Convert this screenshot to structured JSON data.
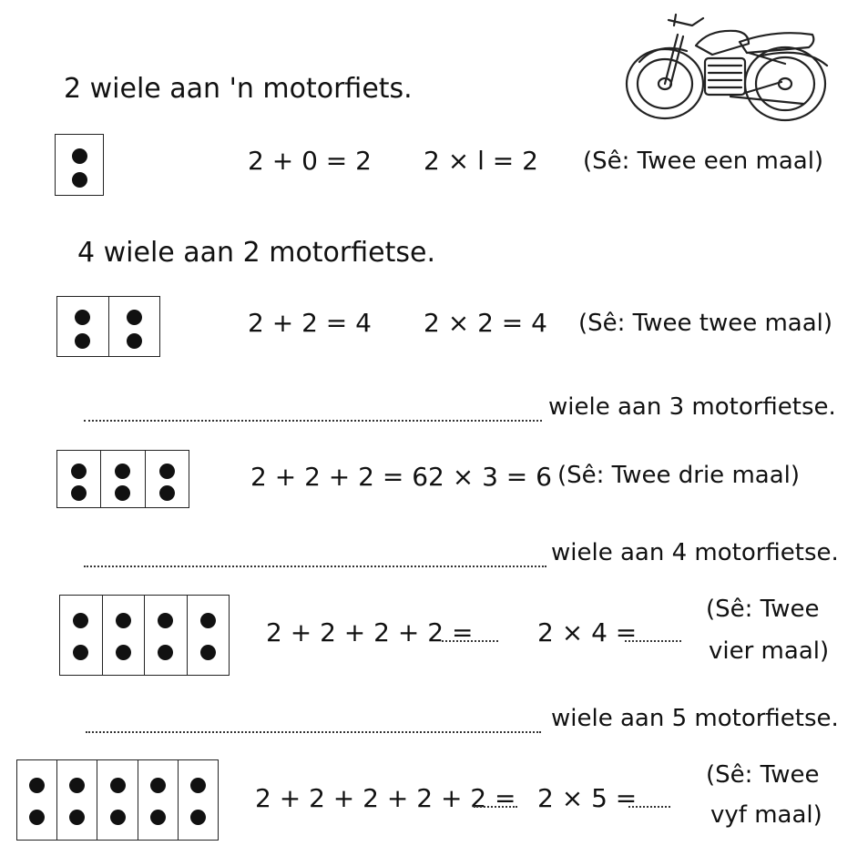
{
  "rows": [
    {
      "heading": "2 wiele aan 'n motorfiets.",
      "cells": 1,
      "addition": "2 + 0 = 2",
      "multiplication": "2 × l = 2",
      "say": "(Sê: Twee een maal)"
    },
    {
      "heading": "4 wiele aan 2 motorfietse.",
      "cells": 2,
      "addition": "2 + 2 = 4",
      "multiplication": "2 × 2 = 4",
      "say": "(Sê: Twee twee maal)"
    },
    {
      "heading_suffix": "wiele aan 3 motorfietse.",
      "cells": 3,
      "addition": "2 + 2 + 2 = 6",
      "multiplication": "2 × 3 = 6",
      "say": "(Sê: Twee drie maal)"
    },
    {
      "heading_suffix": "wiele aan 4 motorfietse.",
      "cells": 4,
      "addition": "2 + 2 + 2 + 2 =",
      "multiplication": "2 × 4 =",
      "say_line1": "(Sê: Twee",
      "say_line2": "vier maal)"
    },
    {
      "heading_suffix": "wiele aan 5 motorfietse.",
      "cells": 5,
      "addition": "2 + 2 + 2 + 2 + 2 =",
      "multiplication": "2 × 5 =",
      "say_line1": "(Sê: Twee",
      "say_line2": "vyf maal)"
    }
  ],
  "illustration": "motorcycle-icon"
}
